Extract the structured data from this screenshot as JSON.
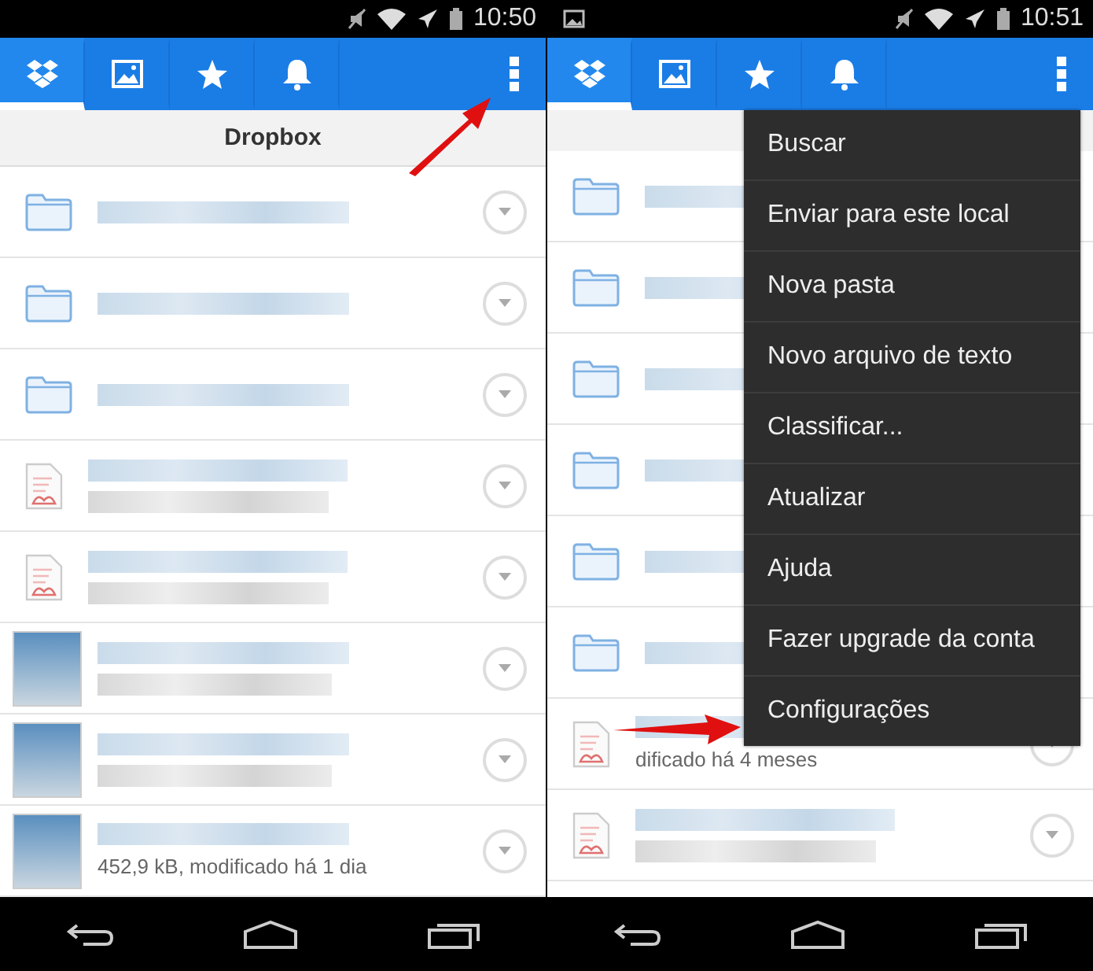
{
  "screens": [
    {
      "status_bar": {
        "time": "10:50"
      },
      "tabs": [
        {
          "selected": true
        },
        {
          "selected": false
        },
        {
          "selected": false
        },
        {
          "selected": false
        }
      ],
      "title": "Dropbox",
      "rows": [
        {
          "kind": "folder"
        },
        {
          "kind": "folder"
        },
        {
          "kind": "folder"
        },
        {
          "kind": "pdf"
        },
        {
          "kind": "pdf"
        },
        {
          "kind": "photo"
        },
        {
          "kind": "photo"
        },
        {
          "kind": "photo",
          "meta": "452,9 kB, modificado há 1 dia"
        }
      ]
    },
    {
      "status_bar": {
        "time": "10:51"
      },
      "tabs": [
        {
          "selected": true
        },
        {
          "selected": false
        },
        {
          "selected": false
        },
        {
          "selected": false
        }
      ],
      "rows": [
        {
          "kind": "folder"
        },
        {
          "kind": "folder"
        },
        {
          "kind": "folder"
        },
        {
          "kind": "folder"
        },
        {
          "kind": "folder"
        },
        {
          "kind": "folder"
        },
        {
          "kind": "pdf",
          "meta": "dificado há 4 meses"
        },
        {
          "kind": "pdf"
        }
      ],
      "menu": [
        "Buscar",
        "Enviar para este local",
        "Nova pasta",
        "Novo arquivo de texto",
        "Classificar...",
        "Atualizar",
        "Ajuda",
        "Fazer upgrade da conta",
        "Configurações"
      ]
    }
  ]
}
